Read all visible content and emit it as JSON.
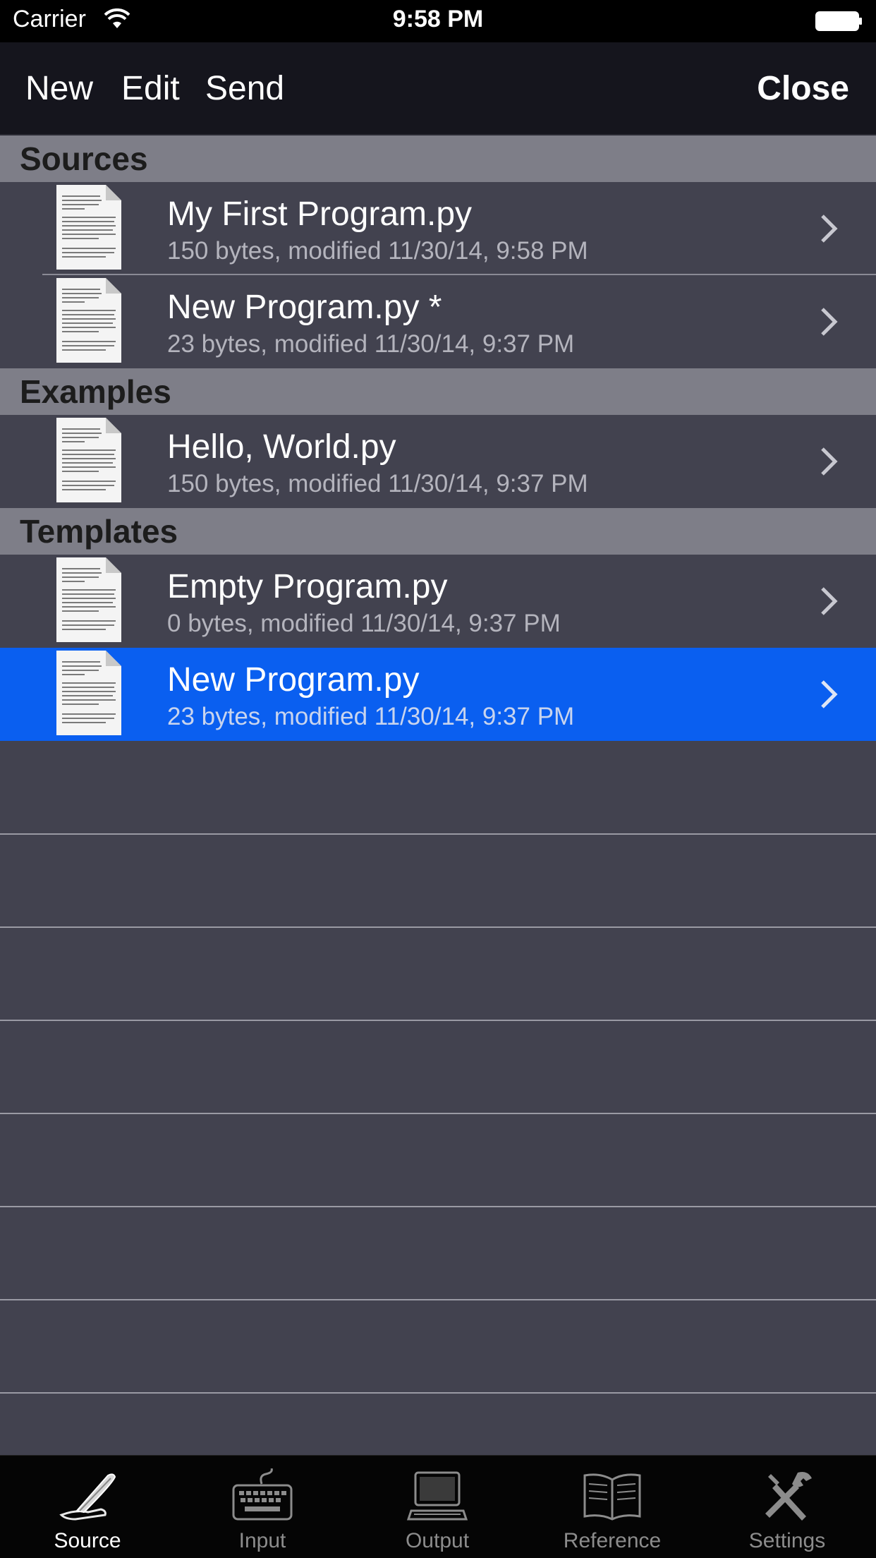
{
  "status_bar": {
    "carrier": "Carrier",
    "time": "9:58 PM"
  },
  "nav": {
    "new_label": "New",
    "edit_label": "Edit",
    "send_label": "Send",
    "close_label": "Close"
  },
  "sections": [
    {
      "title": "Sources",
      "items": [
        {
          "name": "My First Program.py",
          "meta": "150 bytes, modified 11/30/14, 9:58 PM"
        },
        {
          "name": "New Program.py *",
          "meta": "23 bytes, modified 11/30/14, 9:37 PM"
        }
      ]
    },
    {
      "title": "Examples",
      "items": [
        {
          "name": "Hello, World.py",
          "meta": "150 bytes, modified 11/30/14, 9:37 PM"
        }
      ]
    },
    {
      "title": "Templates",
      "items": [
        {
          "name": "Empty Program.py",
          "meta": "0 bytes, modified 11/30/14, 9:37 PM"
        },
        {
          "name": "New Program.py",
          "meta": "23 bytes, modified 11/30/14, 9:37 PM",
          "selected": true
        }
      ]
    }
  ],
  "tabs": [
    {
      "label": "Source",
      "icon": "quill-pen-icon",
      "active": true
    },
    {
      "label": "Input",
      "icon": "keyboard-icon"
    },
    {
      "label": "Output",
      "icon": "computer-monitor-icon"
    },
    {
      "label": "Reference",
      "icon": "book-icon"
    },
    {
      "label": "Settings",
      "icon": "tools-icon"
    }
  ],
  "colors": {
    "background": "#42424f",
    "section_header": "#7e7e88",
    "selected_row": "#0a5ff0",
    "nav_bar": "#15151d",
    "tab_bar": "#050505"
  }
}
